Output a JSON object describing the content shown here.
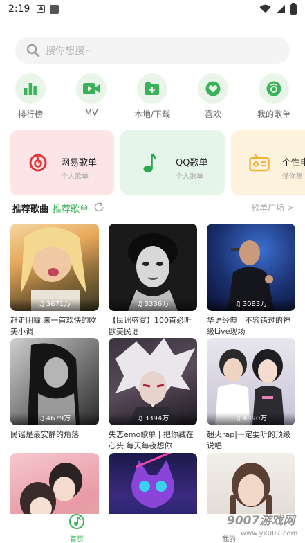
{
  "status_bar": {
    "time": "2:19",
    "a_icon": "A"
  },
  "search": {
    "placeholder": "搜你想搜~"
  },
  "quick_nav": [
    {
      "label": "排行榜",
      "icon": "bar-chart-icon"
    },
    {
      "label": "MV",
      "icon": "video-icon"
    },
    {
      "label": "本地/下载",
      "icon": "download-folder-icon"
    },
    {
      "label": "喜欢",
      "icon": "heart-icon"
    },
    {
      "label": "我的歌单",
      "icon": "music-disc-icon"
    }
  ],
  "cards": [
    {
      "title": "网易歌单",
      "subtitle": "个人歌单",
      "color": "#fde4e6",
      "icon": "netease-icon"
    },
    {
      "title": "QQ歌单",
      "subtitle": "个人歌单",
      "color": "#e6f5ea",
      "icon": "music-note-icon"
    },
    {
      "title": "个性电",
      "subtitle": "懂你想",
      "color": "#fdf2dc",
      "icon": "radio-icon"
    }
  ],
  "section": {
    "tab_recommend_songs": "推荐歌曲",
    "tab_recommend_playlists": "推荐歌单",
    "plaza": "歌单广场 >"
  },
  "playlists": [
    {
      "count": "3671万",
      "title": "赶走阴霾 来一首欢快的欧美小调"
    },
    {
      "count": "3336万",
      "title": "【民谣盛宴】100首必听欧美民谣"
    },
    {
      "count": "3083万",
      "title": "华语经典丨不容错过的神级Live现场"
    },
    {
      "count": "4679万",
      "title": "民谣是最安静的角落"
    },
    {
      "count": "3394万",
      "title": "失恋emo歌单 | 把你藏在心头 每天每夜想你"
    },
    {
      "count": "4390万",
      "title": "超火rap|一定要听的顶级说唱"
    },
    {
      "count": "",
      "title": ""
    },
    {
      "count": "",
      "title": ""
    },
    {
      "count": "",
      "title": ""
    }
  ],
  "bottom_nav": {
    "home": "首页",
    "mine": "我的"
  },
  "watermark": {
    "main": "9007游戏网",
    "url": "www.yx007.com"
  },
  "colors": {
    "accent": "#3ab25a",
    "netease_red": "#e3343a"
  }
}
